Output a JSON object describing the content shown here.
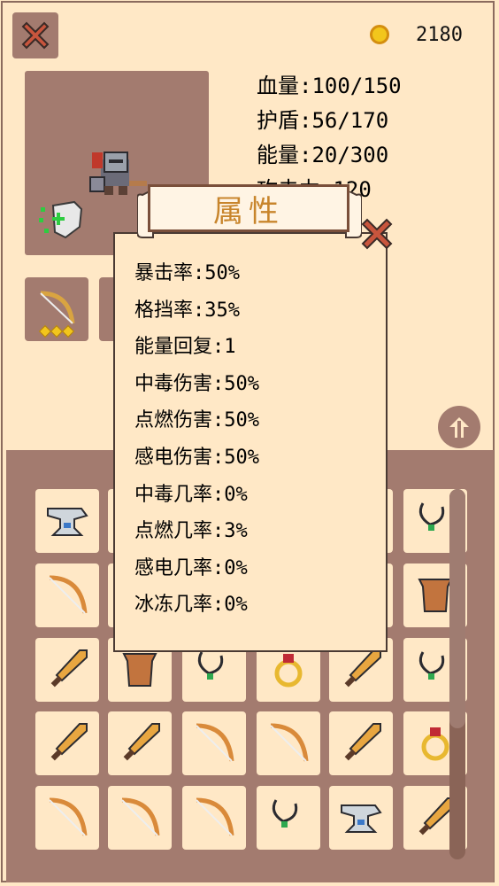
{
  "header": {
    "close_icon": "close-x-icon",
    "coin_icon": "gold-coin-icon",
    "coins": "2180"
  },
  "stats": [
    "血量:100/150",
    "护盾:56/170",
    "能量:20/300",
    "攻击力:120"
  ],
  "popup": {
    "title": "属性",
    "lines": [
      "暴击率:50%",
      "格挡率:35%",
      "能量回复:1",
      "中毒伤害:50%",
      "点燃伤害:50%",
      "感电伤害:50%",
      "中毒几率:0%",
      "点燃几率:3%",
      "感电几率:0%",
      "冰冻几率:0%"
    ]
  },
  "equipment": [
    {
      "icon": "bow-icon",
      "stars": 3
    },
    {
      "icon": "equipment-slot",
      "stars": 0
    }
  ],
  "inventory": [
    [
      "anvil-icon",
      "",
      "",
      "",
      "",
      "necklace-icon"
    ],
    [
      "bow-icon",
      "",
      "",
      "",
      "",
      "armor-icon"
    ],
    [
      "sword-icon",
      "armor-icon",
      "necklace-icon",
      "ring-icon",
      "sword-icon",
      "necklace-icon"
    ],
    [
      "sword-icon",
      "sword-icon",
      "bow-icon",
      "bow-icon",
      "sword-icon",
      "ring-icon"
    ],
    [
      "bow-icon",
      "bow-icon",
      "bow-icon",
      "necklace-icon",
      "anvil-icon",
      "sword-icon"
    ]
  ],
  "colors": {
    "background": "#ffe8c6",
    "panel": "#a37b6f",
    "close_red": "#c8553d",
    "title_orange": "#c8852c",
    "coin": "#f2c61c"
  }
}
